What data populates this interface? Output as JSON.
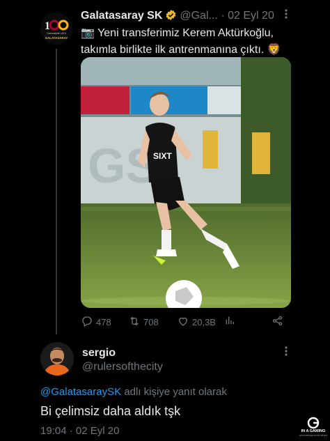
{
  "tweet": {
    "author_name": "Galatasaray SK",
    "author_handle": "@Gal...",
    "dot": "·",
    "date": "02 Eyl 20",
    "text_line1": "📷 Yeni transferimiz Kerem Aktürkoğlu,",
    "text_line2": "takımla birlikte ilk antrenmanına çıktı.",
    "emoji_end": "🦁",
    "avatar": {
      "badge_text": "Cumhuriyetin 100'ü",
      "club_text": "GALATASARAY"
    },
    "photo": {
      "shirt_sponsor": "SIXT"
    },
    "stats": {
      "replies": "478",
      "retweets": "708",
      "likes": "20,3B"
    }
  },
  "reply": {
    "user_name": "sergio",
    "user_handle": "@rulersofthecity",
    "mention": "@GalatasaraySK",
    "replying_to_suffix": " adlı kişiye yanıt olarak",
    "text": "Bi çelimsiz daha aldık tşk",
    "time": "19:04",
    "dot": "·",
    "date": "02 Eyl 20"
  },
  "watermark": {
    "line1": "IN A GAMING",
    "line2": "EN POPÜLER OYUN SİTESİ"
  },
  "colors": {
    "background": "#000000",
    "text": "#e7e9ea",
    "muted": "#71767b",
    "link": "#1d9bf0",
    "verified": "#e8b923"
  },
  "icons": [
    "verified-icon",
    "more-icon",
    "reply-icon",
    "retweet-icon",
    "like-icon",
    "analytics-icon",
    "share-icon"
  ]
}
